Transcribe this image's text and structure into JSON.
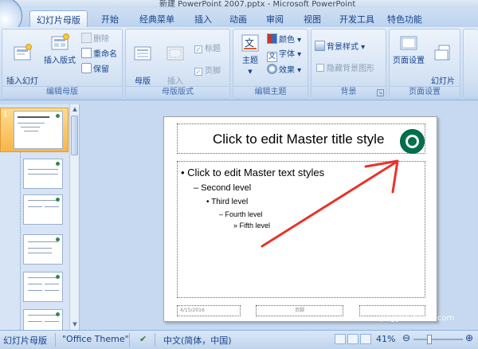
{
  "window": {
    "title": "新建 PowerPoint 2007.pptx - Microsoft PowerPoint"
  },
  "tabs": [
    {
      "label": "幻灯片母版",
      "active": true
    },
    {
      "label": "开始"
    },
    {
      "label": "经典菜单"
    },
    {
      "label": "插入"
    },
    {
      "label": "动画"
    },
    {
      "label": "审阅"
    },
    {
      "label": "视图"
    },
    {
      "label": "开发工具"
    },
    {
      "label": "特色功能"
    }
  ],
  "ribbon": {
    "edit_master": {
      "label": "编辑母版",
      "insert_slide_master": "插入幻灯\n片母版",
      "insert_layout": "插入版式",
      "delete": "删除",
      "rename": "重命名",
      "preserve": "保留"
    },
    "master_layout": {
      "label": "母版版式",
      "master_layout_btn": "母版\n版式",
      "insert_placeholder": "插入\n占位符",
      "title_chk": "标题",
      "footer_chk": "页脚"
    },
    "edit_theme": {
      "label": "编辑主题",
      "theme": "主题",
      "colors": "颜色",
      "fonts": "字体",
      "effects": "效果"
    },
    "background": {
      "label": "背景",
      "background_styles": "背景样式",
      "hide_background": "隐藏背景图形"
    },
    "page_setup": {
      "label": "页面设置",
      "page_setup_btn": "页面设置",
      "orientation": "幻灯片\n方向"
    }
  },
  "thumbs": {
    "selected_number": "1"
  },
  "slide": {
    "title": "Click to edit Master title style",
    "body": [
      "• Click to edit Master text styles",
      "– Second level",
      "• Third level",
      "– Fourth level",
      "» Fifth level"
    ],
    "footer_date": "4/15/2016",
    "footer_center": "页脚"
  },
  "status": {
    "view": "幻灯片母版",
    "theme": "\"Office Theme\"",
    "language": "中文(简体，中国)",
    "zoom": "41%"
  },
  "watermark": "jingyan.baidu.com",
  "colors": {
    "accent_red": "#e8332a",
    "logo_green": "#00704a",
    "selected_thumb": "#f8b54a"
  }
}
